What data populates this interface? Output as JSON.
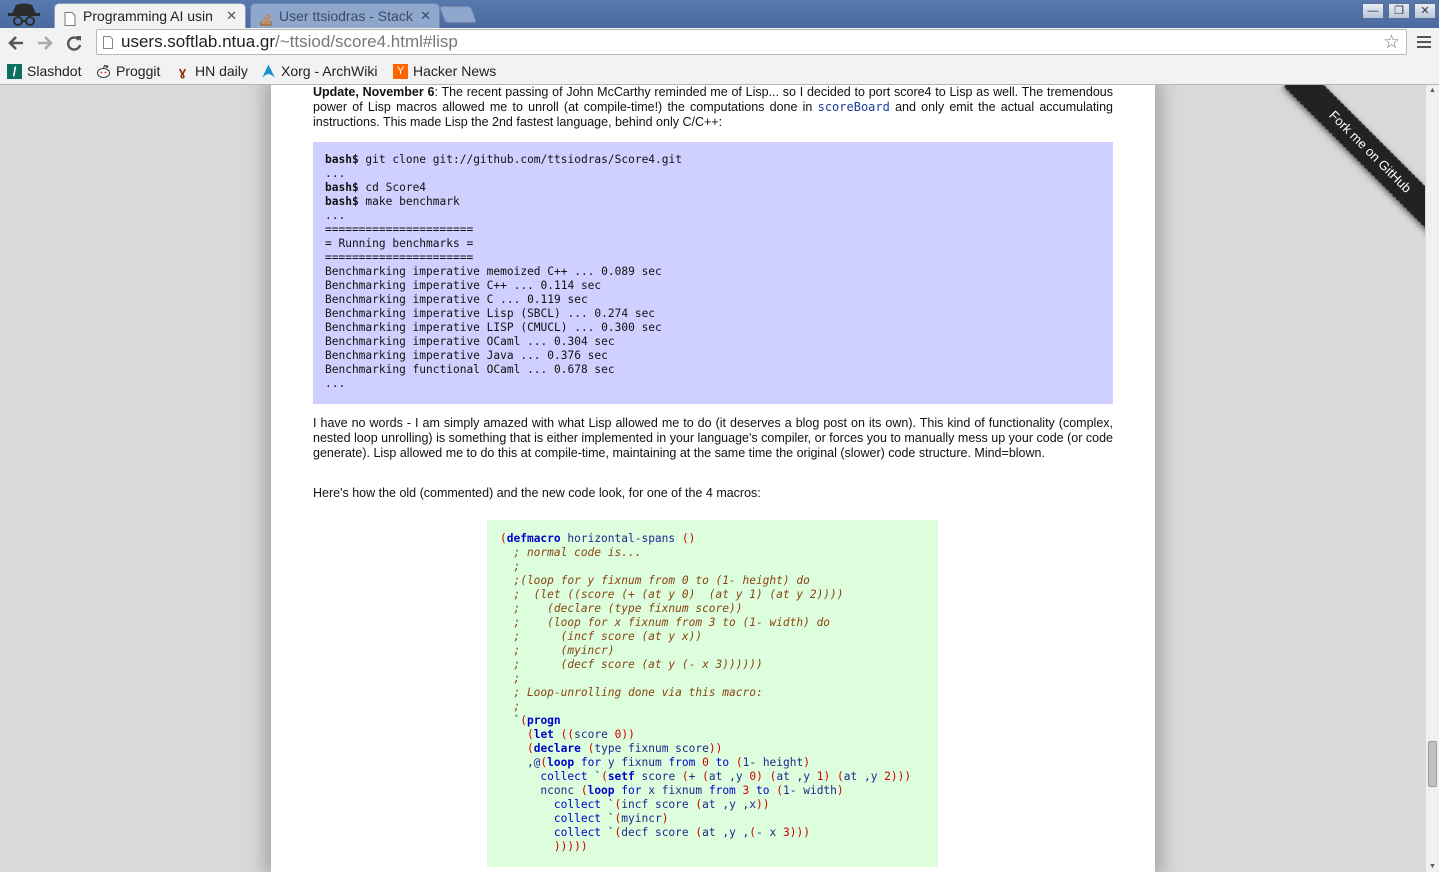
{
  "tabs": [
    {
      "title": "Programming AI usin",
      "active": true
    },
    {
      "title": "User ttsiodras - Stack",
      "active": false
    }
  ],
  "window_controls": {
    "minimize": "—",
    "restore": "❐",
    "close": "✕"
  },
  "address_bar": {
    "host": "users.softlab.ntua.gr",
    "path": "/~ttsiod/score4.html#lisp"
  },
  "bookmarks": [
    {
      "label": "Slashdot",
      "icon": "slashdot-icon"
    },
    {
      "label": "Proggit",
      "icon": "reddit-icon"
    },
    {
      "label": "HN daily",
      "icon": "hn-daily-icon"
    },
    {
      "label": "Xorg - ArchWiki",
      "icon": "archlinux-icon"
    },
    {
      "label": "Hacker News",
      "icon": "ycombinator-icon"
    }
  ],
  "article": {
    "update_bold": "Update, November 6",
    "update_text_1": ": The recent passing of John McCarthy reminded me of Lisp... so I decided to port score4 to Lisp as well. The tremendous power of Lisp macros allowed me to unroll (at compile-time!) the computations done in ",
    "update_code": "scoreBoard",
    "update_text_2": " and only emit the actual accumulating instructions. This made Lisp the 2nd fastest language, behind only C/C++:",
    "bash_block": [
      {
        "prompt": "bash$",
        "text": " git clone git://github.com/ttsiodras/Score4.git"
      },
      {
        "prompt": "",
        "text": "..."
      },
      {
        "prompt": "bash$",
        "text": " cd Score4"
      },
      {
        "prompt": "bash$",
        "text": " make benchmark"
      },
      {
        "prompt": "",
        "text": "..."
      },
      {
        "prompt": "",
        "text": "======================"
      },
      {
        "prompt": "",
        "text": "= Running benchmarks ="
      },
      {
        "prompt": "",
        "text": "======================"
      },
      {
        "prompt": "",
        "text": "Benchmarking imperative memoized C++ ... 0.089 sec"
      },
      {
        "prompt": "",
        "text": "Benchmarking imperative C++ ... 0.114 sec"
      },
      {
        "prompt": "",
        "text": "Benchmarking imperative C ... 0.119 sec"
      },
      {
        "prompt": "",
        "text": "Benchmarking imperative Lisp (SBCL) ... 0.274 sec"
      },
      {
        "prompt": "",
        "text": "Benchmarking imperative LISP (CMUCL) ... 0.300 sec"
      },
      {
        "prompt": "",
        "text": "Benchmarking imperative OCaml ... 0.304 sec"
      },
      {
        "prompt": "",
        "text": "Benchmarking imperative Java ... 0.376 sec"
      },
      {
        "prompt": "",
        "text": "Benchmarking functional OCaml ... 0.678 sec"
      },
      {
        "prompt": "",
        "text": "..."
      }
    ],
    "para2": "I have no words - I am simply amazed with what Lisp allowed me to do (it deserves a blog post on its own). This kind of functionality (complex, nested loop unrolling) is something that is either implemented in your language's compiler, or forces you to manually mess up your code (or code generate). Lisp allowed me to do this at compile-time, maintaining at the same time the original (slower) code structure. Mind=blown.",
    "para3": "Here's how the old (commented) and the new code look, for one of the 4 macros:",
    "lisp_code": [
      [
        [
          "par",
          "("
        ],
        [
          "kw",
          "defmacro"
        ],
        [
          "sym",
          " horizontal-spans "
        ],
        [
          "par",
          "()"
        ]
      ],
      [
        [
          "cm",
          "  ; normal code is..."
        ]
      ],
      [
        [
          "cm",
          "  ;"
        ]
      ],
      [
        [
          "cm",
          "  ;(loop for y fixnum from 0 to (1- height) do"
        ]
      ],
      [
        [
          "cm",
          "  ;  (let ((score (+ (at y 0)  (at y 1) (at y 2))))"
        ]
      ],
      [
        [
          "cm",
          "  ;    (declare (type fixnum score))"
        ]
      ],
      [
        [
          "cm",
          "  ;    (loop for x fixnum from 3 to (1- width) do"
        ]
      ],
      [
        [
          "cm",
          "  ;      (incf score (at y x))"
        ]
      ],
      [
        [
          "cm",
          "  ;      (myincr)"
        ]
      ],
      [
        [
          "cm",
          "  ;      (decf score (at y (- x 3))))))"
        ]
      ],
      [
        [
          "cm",
          "  ;"
        ]
      ],
      [
        [
          "cm",
          "  ; Loop-unrolling done via this macro:"
        ]
      ],
      [
        [
          "cm",
          "  ;"
        ]
      ],
      [
        [
          "sym",
          "  `"
        ],
        [
          "par",
          "("
        ],
        [
          "kw",
          "progn"
        ]
      ],
      [
        [
          "sym",
          "    "
        ],
        [
          "par",
          "("
        ],
        [
          "kw",
          "let"
        ],
        [
          "sym",
          " "
        ],
        [
          "par",
          "(("
        ],
        [
          "sym",
          "score "
        ],
        [
          "num",
          "0"
        ],
        [
          "par",
          "))"
        ]
      ],
      [
        [
          "sym",
          "    "
        ],
        [
          "par",
          "("
        ],
        [
          "kw",
          "declare"
        ],
        [
          "sym",
          " "
        ],
        [
          "par",
          "("
        ],
        [
          "sym",
          "type fixnum score"
        ],
        [
          "par",
          "))"
        ]
      ],
      [
        [
          "sym",
          "    ,@"
        ],
        [
          "par",
          "("
        ],
        [
          "kw",
          "loop"
        ],
        [
          "fn",
          " for"
        ],
        [
          "sym",
          " y fixnum "
        ],
        [
          "fn",
          "from"
        ],
        [
          "sym",
          " "
        ],
        [
          "num",
          "0"
        ],
        [
          "fn",
          " to"
        ],
        [
          "sym",
          " "
        ],
        [
          "par",
          "("
        ],
        [
          "sym",
          "1- height"
        ],
        [
          "par",
          ")"
        ]
      ],
      [
        [
          "sym",
          "      "
        ],
        [
          "fn",
          "collect"
        ],
        [
          "sym",
          " `"
        ],
        [
          "par",
          "("
        ],
        [
          "kw",
          "setf"
        ],
        [
          "sym",
          " score "
        ],
        [
          "par",
          "("
        ],
        [
          "sym",
          "+ "
        ],
        [
          "par",
          "("
        ],
        [
          "sym",
          "at ,y "
        ],
        [
          "num",
          "0"
        ],
        [
          "par",
          ")"
        ],
        [
          "sym",
          " "
        ],
        [
          "par",
          "("
        ],
        [
          "sym",
          "at ,y "
        ],
        [
          "num",
          "1"
        ],
        [
          "par",
          ")"
        ],
        [
          "sym",
          " "
        ],
        [
          "par",
          "("
        ],
        [
          "sym",
          "at ,y "
        ],
        [
          "num",
          "2"
        ],
        [
          "par",
          ")))"
        ]
      ],
      [
        [
          "sym",
          "      nconc "
        ],
        [
          "par",
          "("
        ],
        [
          "kw",
          "loop"
        ],
        [
          "fn",
          " for"
        ],
        [
          "sym",
          " x fixnum "
        ],
        [
          "fn",
          "from"
        ],
        [
          "sym",
          " "
        ],
        [
          "num",
          "3"
        ],
        [
          "fn",
          " to"
        ],
        [
          "sym",
          " "
        ],
        [
          "par",
          "("
        ],
        [
          "sym",
          "1- width"
        ],
        [
          "par",
          ")"
        ]
      ],
      [
        [
          "sym",
          "        "
        ],
        [
          "fn",
          "collect"
        ],
        [
          "sym",
          " `"
        ],
        [
          "par",
          "("
        ],
        [
          "sym",
          "incf score "
        ],
        [
          "par",
          "("
        ],
        [
          "sym",
          "at ,y ,x"
        ],
        [
          "par",
          "))"
        ]
      ],
      [
        [
          "sym",
          "        "
        ],
        [
          "fn",
          "collect"
        ],
        [
          "sym",
          " `"
        ],
        [
          "par",
          "("
        ],
        [
          "sym",
          "myincr"
        ],
        [
          "par",
          ")"
        ]
      ],
      [
        [
          "sym",
          "        "
        ],
        [
          "fn",
          "collect"
        ],
        [
          "sym",
          " `"
        ],
        [
          "par",
          "("
        ],
        [
          "sym",
          "decf score "
        ],
        [
          "par",
          "("
        ],
        [
          "sym",
          "at ,y ,"
        ],
        [
          "par",
          "("
        ],
        [
          "sym",
          "- x "
        ],
        [
          "num",
          "3"
        ],
        [
          "par",
          ")))"
        ]
      ],
      [
        [
          "sym",
          "        "
        ],
        [
          "par",
          ")))))"
        ]
      ]
    ]
  },
  "ribbon": {
    "label": "Fork me on GitHub"
  },
  "colors": {
    "bash_bg": "#cfd0ff",
    "lisp_bg": "#dcfedc",
    "tabbar": "#5879ad"
  }
}
